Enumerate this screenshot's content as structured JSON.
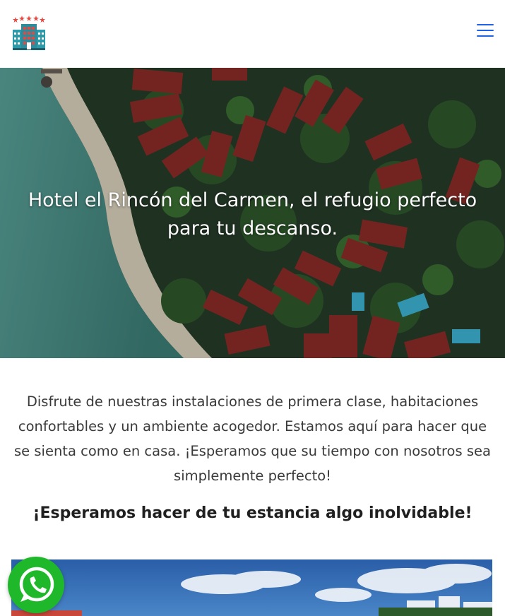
{
  "header": {
    "logo_icon": "hotel-building-icon",
    "menu_icon": "hamburger-menu-icon",
    "accent_color": "#1f63e6"
  },
  "hero": {
    "title": "Hotel el Rincón del Carmen, el refugio perfecto para tu descanso."
  },
  "intro": {
    "paragraph": "Disfrute de nuestras instalaciones de primera clase, habitaciones confortables y un ambiente acogedor. Estamos aquí para hacer que se sienta como en casa. ¡Esperamos que su tiempo con nosotros sea simplemente perfecto!",
    "tagline": "¡Esperamos hacer de tu estancia algo inolvidable!"
  },
  "floating": {
    "whatsapp_icon": "whatsapp-icon",
    "whatsapp_color": "#1fb82b"
  }
}
